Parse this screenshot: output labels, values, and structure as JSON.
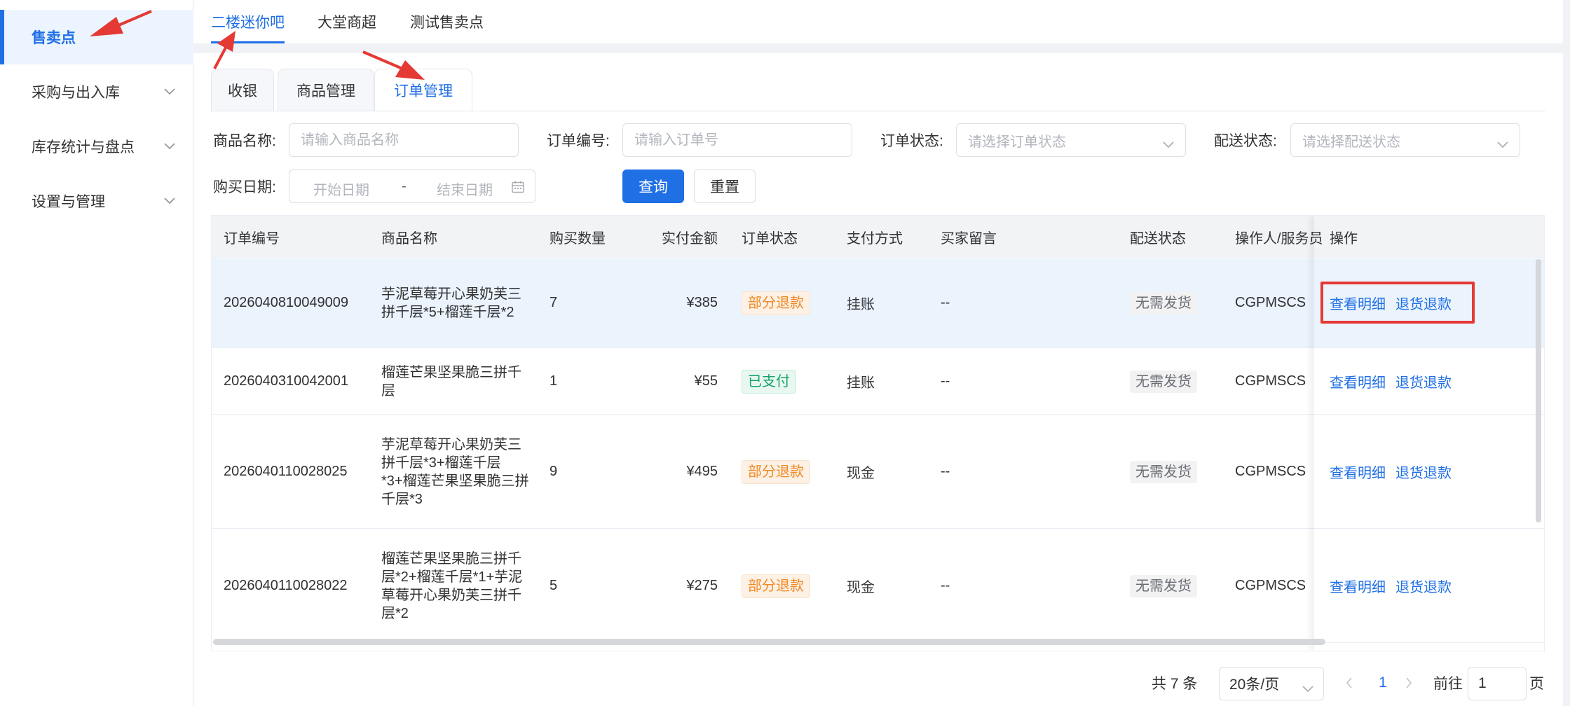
{
  "sidebar": {
    "items": [
      {
        "label": "售卖点",
        "active": true
      },
      {
        "label": "采购与出入库"
      },
      {
        "label": "库存统计与盘点"
      },
      {
        "label": "设置与管理"
      }
    ]
  },
  "top_tabs": [
    {
      "label": "二楼迷你吧",
      "active": true
    },
    {
      "label": "大堂商超"
    },
    {
      "label": "测试售卖点"
    }
  ],
  "panel_tabs": [
    {
      "label": "收银"
    },
    {
      "label": "商品管理"
    },
    {
      "label": "订单管理",
      "active": true
    }
  ],
  "filters": {
    "product_name_label": "商品名称:",
    "product_name_placeholder": "请输入商品名称",
    "order_no_label": "订单编号:",
    "order_no_placeholder": "请输入订单号",
    "order_status_label": "订单状态:",
    "order_status_placeholder": "请选择订单状态",
    "delivery_status_label": "配送状态:",
    "delivery_status_placeholder": "请选择配送状态",
    "purchase_date_label": "购买日期:",
    "start_date_placeholder": "开始日期",
    "date_separator": "-",
    "end_date_placeholder": "结束日期",
    "search_button": "查询",
    "reset_button": "重置"
  },
  "table": {
    "headers": [
      "订单编号",
      "商品名称",
      "购买数量",
      "实付金额",
      "订单状态",
      "支付方式",
      "买家留言",
      "配送状态",
      "操作人/服务员",
      "操作"
    ],
    "rows": [
      {
        "order_no": "2026040810049009",
        "product": "芋泥草莓开心果奶芙三拼千层*5+榴莲千层*2",
        "qty": "7",
        "amount": "¥385",
        "status": "部分退款",
        "status_color": "#f08a24",
        "payment": "挂账",
        "message": "--",
        "delivery": "无需发货",
        "operator": "CGPMSCS",
        "action_detail": "查看明细",
        "action_refund": "退货退款"
      },
      {
        "order_no": "2026040310042001",
        "product": "榴莲芒果坚果脆三拼千层",
        "qty": "1",
        "amount": "¥55",
        "status": "已支付",
        "status_color": "#16a36b",
        "payment": "挂账",
        "message": "--",
        "delivery": "无需发货",
        "operator": "CGPMSCS",
        "action_detail": "查看明细",
        "action_refund": "退货退款"
      },
      {
        "order_no": "2026040110028025",
        "product": "芋泥草莓开心果奶芙三拼千层*3+榴莲千层*3+榴莲芒果坚果脆三拼千层*3",
        "qty": "9",
        "amount": "¥495",
        "status": "部分退款",
        "status_color": "#f08a24",
        "payment": "现金",
        "message": "--",
        "delivery": "无需发货",
        "operator": "CGPMSCS",
        "action_detail": "查看明细",
        "action_refund": "退货退款"
      },
      {
        "order_no": "2026040110028022",
        "product": "榴莲芒果坚果脆三拼千层*2+榴莲千层*1+芋泥草莓开心果奶芙三拼千层*2",
        "qty": "5",
        "amount": "¥275",
        "status": "部分退款",
        "status_color": "#f08a24",
        "payment": "现金",
        "message": "--",
        "delivery": "无需发货",
        "operator": "CGPMSCS",
        "action_detail": "查看明细",
        "action_refund": "退货退款"
      }
    ]
  },
  "pagination": {
    "total": "共 7 条",
    "page_size": "20条/页",
    "current_page": "1",
    "goto_label": "前往",
    "goto_value": "1",
    "page_suffix": "页"
  },
  "colors": {
    "accent": "#1f6fe5",
    "annotation": "#e53935"
  }
}
